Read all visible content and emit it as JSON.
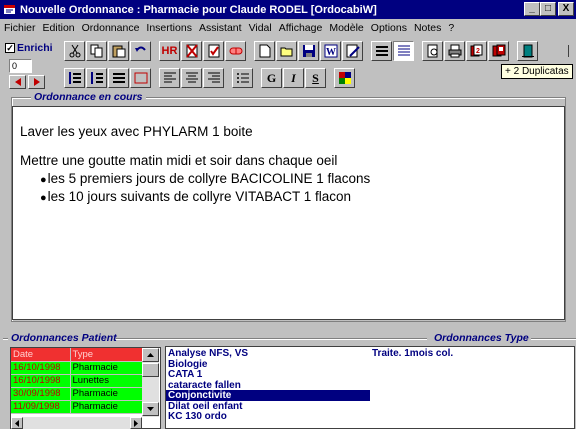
{
  "window": {
    "title": "Nouvelle Ordonnance : Pharmacie pour Claude RODEL [OrdocabiW]",
    "controls": [
      "_",
      "□",
      "X"
    ]
  },
  "menu": [
    "Fichier",
    "Edition",
    "Ordonnance",
    "Insertions",
    "Assistant",
    "Vidal",
    "Affichage",
    "Modèle",
    "Options",
    "Notes",
    "?"
  ],
  "toolbar": {
    "enrichi_label": "Enrichi",
    "enrichi_checked": true,
    "counter_value": "0",
    "hr_label": "HR",
    "bold_label": "G",
    "italic_label": "I",
    "underline_label": "S",
    "tooltip": "+ 2 Duplicatas"
  },
  "ordonnance": {
    "section_label": "Ordonnance en cours",
    "lines": [
      "Laver les yeux avec  PHYLARM  1 boite",
      "Mettre une goutte matin midi et soir dans chaque oeil"
    ],
    "bullets": [
      "les 5 premiers jours de collyre BACICOLINE  1 flacons",
      "les 10 jours suivants de collyre VITABACT  1 flacon"
    ]
  },
  "patient_panel": {
    "label": "Ordonnances Patient",
    "columns": [
      "Date",
      "Type"
    ],
    "rows": [
      [
        "16/10/1998",
        "Pharmacie"
      ],
      [
        "16/10/1998",
        "Lunettes"
      ],
      [
        "30/09/1998",
        "Pharmacie"
      ],
      [
        "11/09/1998",
        "Pharmacie"
      ]
    ]
  },
  "type_panel": {
    "label": "Ordonnances Type",
    "items": [
      "Analyse NFS, VS",
      "Biologie",
      "CATA 1",
      "cataracte fallen",
      "Conjonctivite",
      "Dilat oeil enfant",
      "KC 130 ordo"
    ],
    "selected_index": 4,
    "side_item": "Traite. 1mois col."
  },
  "colors": {
    "titlebar": "#000080",
    "accent_text": "#000080",
    "grid_row": "#00ff00",
    "grid_header": "#f03030"
  }
}
